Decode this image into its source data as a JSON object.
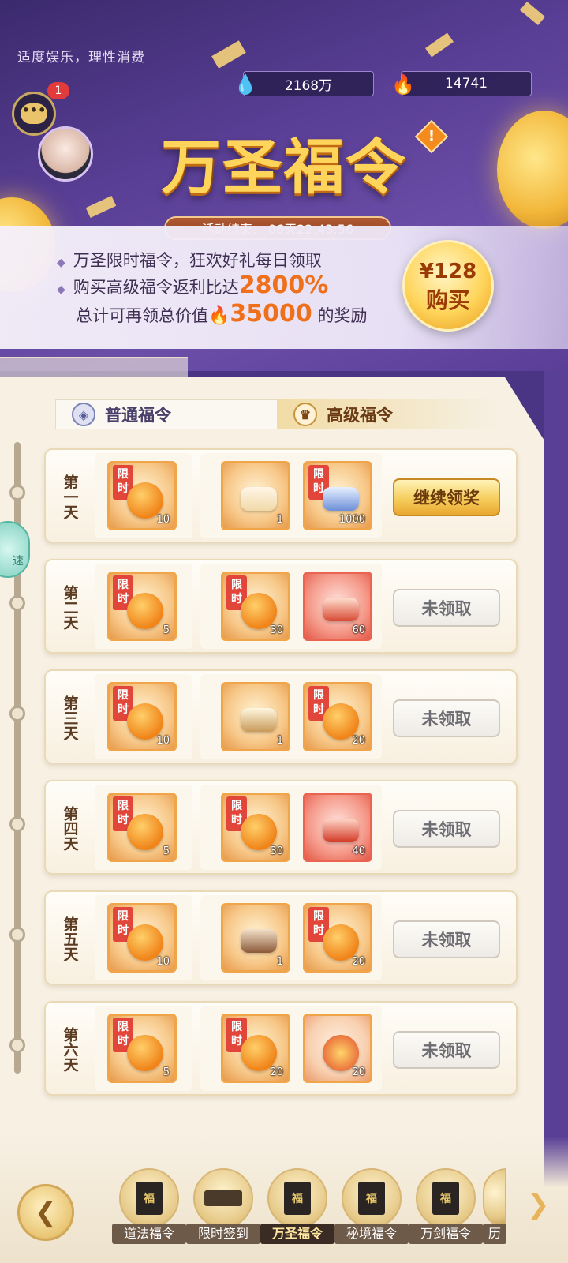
{
  "header": {
    "health_notice": "适度娱乐，理性消费",
    "currency_1": "2168万",
    "currency_2": "14741",
    "chat_badge": "1",
    "title": "万圣福令",
    "alert_mark": "!",
    "countdown_label": "活动结束：",
    "countdown_value": "06天22:43:56"
  },
  "promo": {
    "line1": "万圣限时福令，狂欢好礼每日领取",
    "line2_prefix": "购买高级福令返利比达",
    "line2_highlight": "2800%",
    "line3_prefix": "总计可再领总价值",
    "line3_highlight": "35000",
    "line3_suffix": "的奖励",
    "buy_price": "¥128",
    "buy_label": "购买"
  },
  "tabs": {
    "normal": "普通福令",
    "senior": "高级福令"
  },
  "side_float_label": "速",
  "rows": [
    {
      "day": "第一天",
      "normal_tag": "限时",
      "normal_count": "10",
      "senior1_tag": "",
      "senior1_count": "1",
      "senior2_tag": "限时",
      "senior2_count": "1000",
      "button": "继续领奖"
    },
    {
      "day": "第二天",
      "normal_tag": "限时",
      "normal_count": "5",
      "senior1_tag": "限时",
      "senior1_count": "30",
      "senior2_tag": "",
      "senior2_count": "60",
      "button": "未领取"
    },
    {
      "day": "第三天",
      "normal_tag": "限时",
      "normal_count": "10",
      "senior1_tag": "",
      "senior1_count": "1",
      "senior2_tag": "限时",
      "senior2_count": "20",
      "button": "未领取"
    },
    {
      "day": "第四天",
      "normal_tag": "限时",
      "normal_count": "5",
      "senior1_tag": "限时",
      "senior1_count": "30",
      "senior2_tag": "",
      "senior2_count": "40",
      "button": "未领取"
    },
    {
      "day": "第五天",
      "normal_tag": "限时",
      "normal_count": "10",
      "senior1_tag": "",
      "senior1_count": "1",
      "senior2_tag": "限时",
      "senior2_count": "20",
      "button": "未领取"
    },
    {
      "day": "第六天",
      "normal_tag": "限时",
      "normal_count": "5",
      "senior1_tag": "限时",
      "senior1_count": "20",
      "senior2_tag": "",
      "senior2_count": "20",
      "button": "未领取"
    }
  ],
  "bottom_nav": {
    "items": [
      "道法福令",
      "限时签到",
      "万圣福令",
      "秘境福令",
      "万剑福令",
      "历"
    ],
    "book_char": "福"
  },
  "colors": {
    "accent": "#ffd45a",
    "highlight": "#f06f1b",
    "bg_purple": "#4a3585"
  }
}
